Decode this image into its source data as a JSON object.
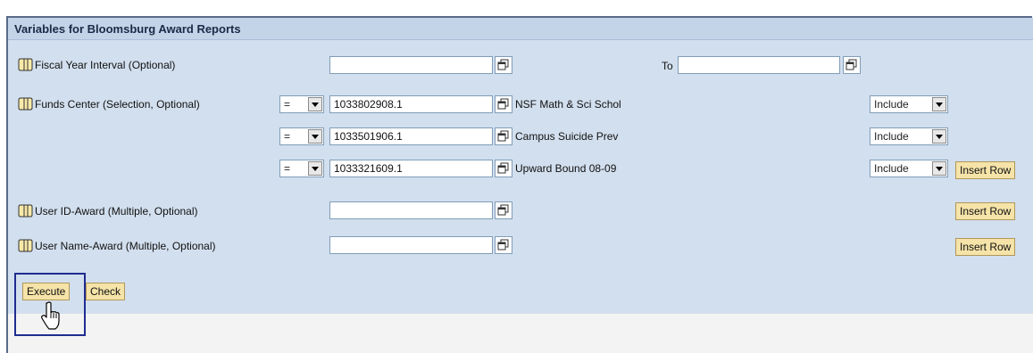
{
  "panel": {
    "title": "Variables for Bloomsburg Award Reports"
  },
  "fiscal_year": {
    "label": "Fiscal Year Interval (Optional)",
    "from_value": "",
    "to_label": "To",
    "to_value": ""
  },
  "funds_center": {
    "label": "Funds Center (Selection, Optional)",
    "rows": [
      {
        "operator": "=",
        "value": "1033802908.1",
        "description": "NSF Math & Sci Schol",
        "mode": "Include"
      },
      {
        "operator": "=",
        "value": "1033501906.1",
        "description": "Campus Suicide Prev",
        "mode": "Include"
      },
      {
        "operator": "=",
        "value": "1033321609.1",
        "description": "Upward Bound 08-09",
        "mode": "Include",
        "action": "Insert Row"
      }
    ]
  },
  "user_id": {
    "label": "User ID-Award (Multiple, Optional)",
    "value": "",
    "action": "Insert Row"
  },
  "user_name": {
    "label": "User Name-Award (Multiple, Optional)",
    "value": "",
    "action": "Insert Row"
  },
  "buttons": {
    "execute": "Execute",
    "check": "Check"
  },
  "icons": {
    "variable": "variable-icon",
    "value-help": "value-help-icon",
    "cursor": "hand-cursor-icon"
  },
  "colors": {
    "panel": "#d2dfee",
    "header": "#c3d3e8",
    "button": "#f5e3a8",
    "highlight": "#1f2c8f"
  }
}
